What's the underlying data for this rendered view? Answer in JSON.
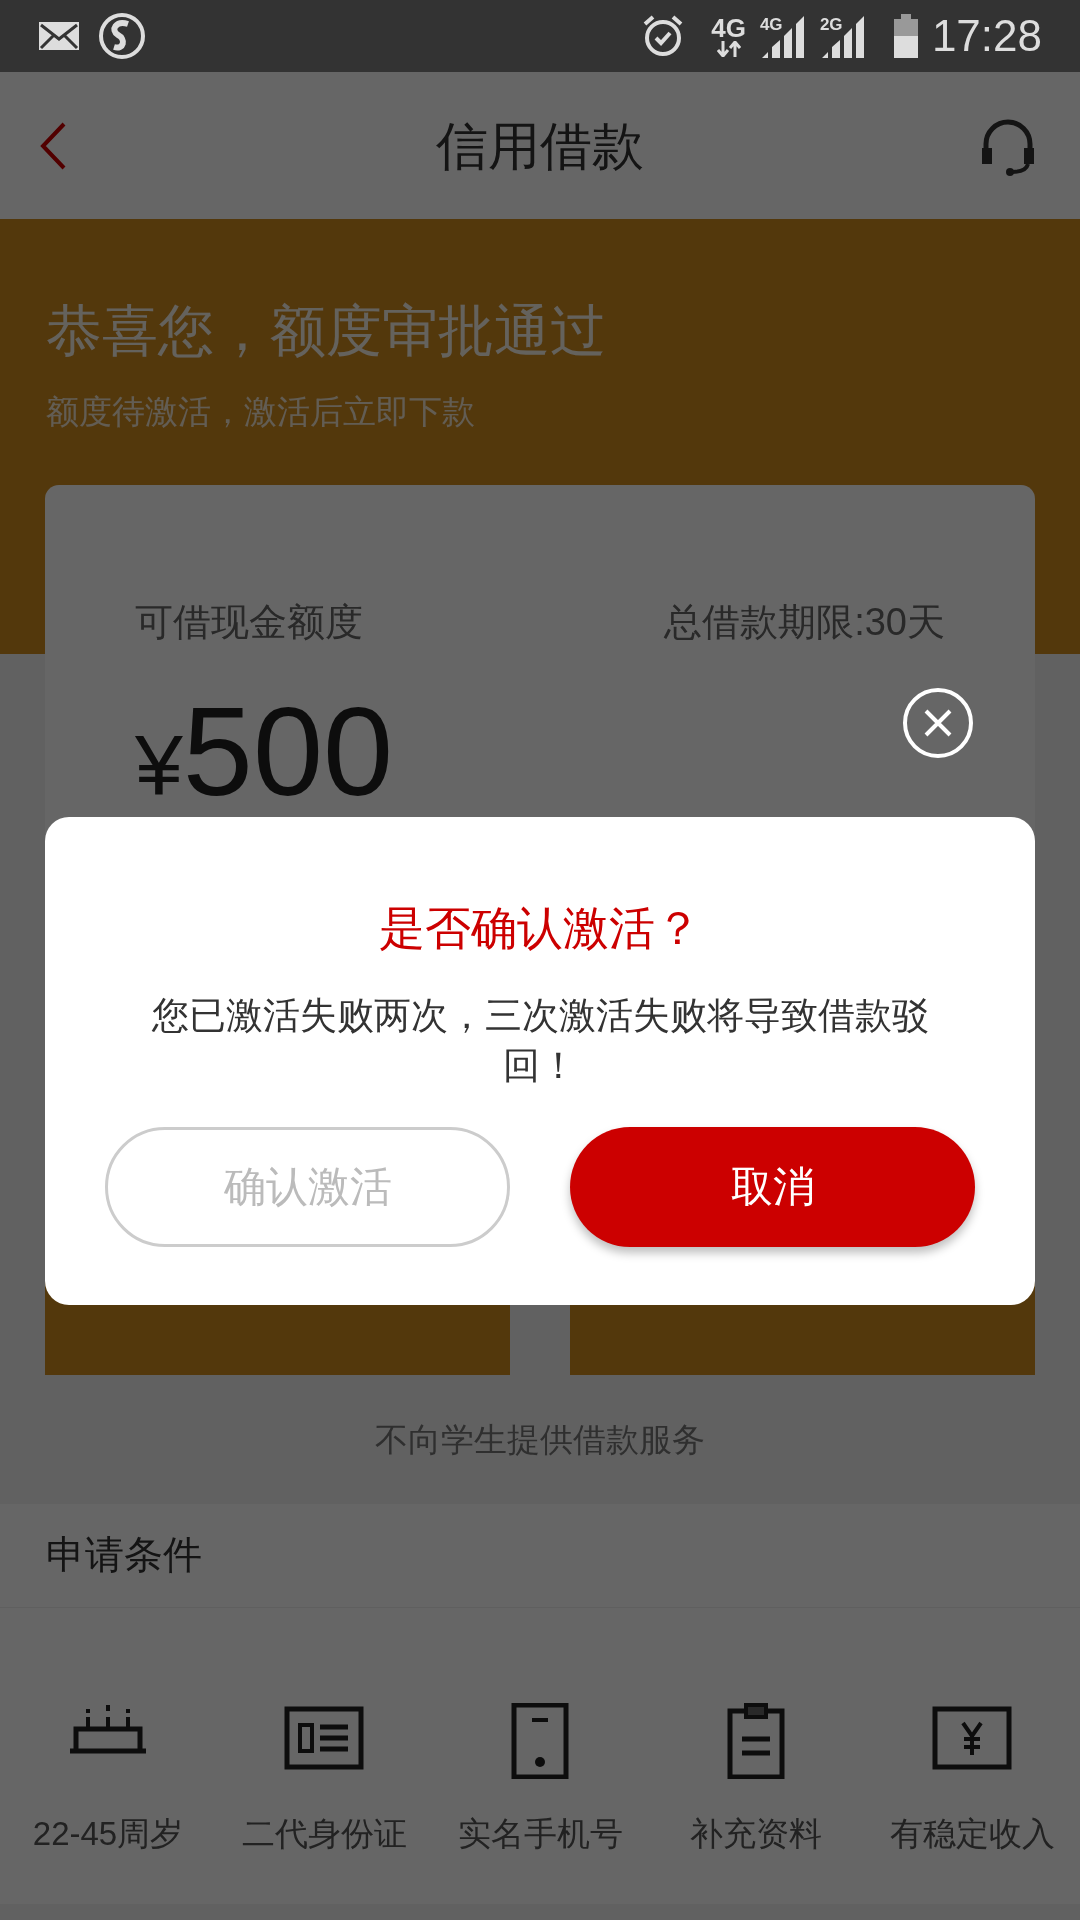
{
  "status_bar": {
    "network": "4G",
    "sim1": "4G",
    "sim2": "2G",
    "time": "17:28"
  },
  "nav": {
    "title": "信用借款"
  },
  "header": {
    "title": "恭喜您，额度审批通过",
    "subtitle": "额度待激活，激活后立即下款"
  },
  "card": {
    "label": "可借现金额度",
    "term": "总借款期限:30天",
    "currency": "¥",
    "amount": "500"
  },
  "notice": "不向学生提供借款服务",
  "requirements": {
    "title": "申请条件",
    "items": [
      {
        "kind": "cake",
        "label": "22-45周岁"
      },
      {
        "kind": "idcard",
        "label": "二代身份证"
      },
      {
        "kind": "phone",
        "label": "实名手机号"
      },
      {
        "kind": "clipboard",
        "label": "补充资料"
      },
      {
        "kind": "bill",
        "label": "有稳定收入"
      }
    ]
  },
  "dialog": {
    "title": "是否确认激活？",
    "message": "您已激活失败两次，三次激活失败将导致借款驳回！",
    "buttons": [
      {
        "kind": "secondary",
        "label": "确认激活"
      },
      {
        "kind": "primary",
        "label": "取消"
      }
    ]
  }
}
